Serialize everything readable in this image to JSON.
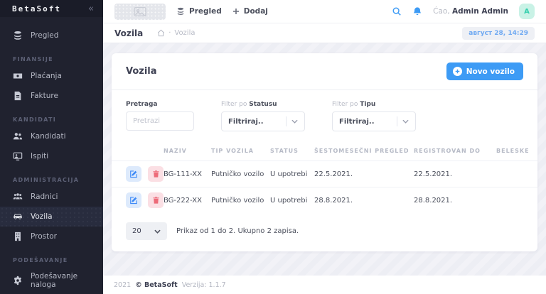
{
  "colors": {
    "accent_blue": "#3d9bf5",
    "sidebar_bg": "#20222f",
    "edit_icon_blue": "#3d8af7",
    "delete_icon_red": "#ed6b79",
    "avatar_bg": "#c9f2e6",
    "avatar_text": "#35cfae",
    "date_badge_text": "#6fa9f2"
  },
  "sidebar": {
    "logo": "BetaSoft",
    "collapse": "«",
    "groups": [
      {
        "items": [
          {
            "label": "Pregled",
            "icon": "layers-icon"
          }
        ]
      },
      {
        "heading": "FINANSIJE",
        "items": [
          {
            "label": "Plaćanja",
            "icon": "banknote-icon"
          },
          {
            "label": "Fakture",
            "icon": "invoice-icon"
          }
        ]
      },
      {
        "heading": "KANDIDATI",
        "items": [
          {
            "label": "Kandidati",
            "icon": "users-icon"
          },
          {
            "label": "Ispiti",
            "icon": "exam-icon"
          }
        ]
      },
      {
        "heading": "ADMINISTRACIJA",
        "items": [
          {
            "label": "Radnici",
            "icon": "workers-icon"
          },
          {
            "label": "Vozila",
            "icon": "car-icon"
          },
          {
            "label": "Prostor",
            "icon": "building-icon"
          }
        ]
      },
      {
        "heading": "PODEŠAVANJE",
        "items": [
          {
            "label": "Podešavanje naloga",
            "icon": "gear-icon"
          }
        ]
      }
    ]
  },
  "header": {
    "nav_pregled": "Pregled",
    "nav_dodaj": "Dodaj",
    "greeting_prefix": "Ćao,",
    "user_name": "Admin Admin",
    "avatar_initial": "A"
  },
  "breadcrumb": {
    "title": "Vozila",
    "separator": "·",
    "path": "Vozila",
    "datetime": "август 28, 14:29"
  },
  "card": {
    "title": "Vozila",
    "new_button": "Novo vozilo",
    "filters": {
      "search_label": "Pretraga",
      "search_placeholder": "Pretrazi",
      "label_prefix": "Filter po",
      "status_label": "Statusu",
      "tip_label": "Tipu",
      "filter_value": "Filtriraj.."
    },
    "table": {
      "headers": [
        "NAZIV",
        "TIP VOZILA",
        "STATUS",
        "ŠESTOMESEČNI PREGLED",
        "REGISTROVAN DO",
        "BELESKE"
      ],
      "rows": [
        {
          "naziv": "BG-111-XX",
          "tip": "Putničko vozilo",
          "status": "U upotrebi",
          "pregled": "22.5.2021.",
          "registrovan": "22.5.2021.",
          "beleske": ""
        },
        {
          "naziv": "BG-222-XX",
          "tip": "Putničko vozilo",
          "status": "U upotrebi",
          "pregled": "28.8.2021.",
          "registrovan": "28.8.2021.",
          "beleske": ""
        }
      ]
    },
    "pagination": {
      "page_size": "20",
      "summary": "Prikaz od 1 do 2. Ukupno 2 zapisa."
    }
  },
  "footer": {
    "year": "2021",
    "brand": "© BetaSoft",
    "version": "Verzija: 1.1.7"
  }
}
